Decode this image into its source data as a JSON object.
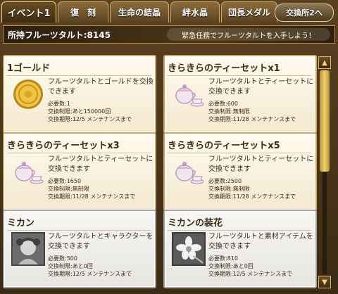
{
  "tabs": [
    {
      "label": "イベント1",
      "active": true
    },
    {
      "label": "復　刻",
      "active": false
    },
    {
      "label": "生命の結晶",
      "active": false
    },
    {
      "label": "絆水晶",
      "active": false
    },
    {
      "label": "団長メダル",
      "active": false
    }
  ],
  "exchange_button": "交換所2へ",
  "info": {
    "owned": "所持フルーツタルト:8145",
    "notice": "緊急任務でフルーツタルトを入手しよう！"
  },
  "items": [
    {
      "title": "1ゴールド",
      "icon": "gold-coin-icon",
      "desc": "フルーツタルトとゴールドを交換できます",
      "required": "必要数:1",
      "limit": "交換制限:あと150000回",
      "deadline": "交換期限:12/5 メンテナンスまで"
    },
    {
      "title": "きらきらのティーセットx1",
      "icon": "tea-set-icon",
      "desc": "フルーツタルトとティーセットに交換できます",
      "required": "必要数:600",
      "limit": "交換制限:無制限",
      "deadline": "交換期限:11/28 メンテナンスまで"
    },
    {
      "title": "きらきらのティーセットx3",
      "icon": "tea-set-icon",
      "desc": "フルーツタルトとティーセットに交換できます",
      "required": "必要数:1650",
      "limit": "交換制限:無制限",
      "deadline": "交換期限:11/28 メンテナンスまで"
    },
    {
      "title": "きらきらのティーセットx5",
      "icon": "tea-set-icon",
      "desc": "フルーツタルトとティーセットに交換できます",
      "required": "必要数:2500",
      "limit": "交換制限:無制限",
      "deadline": "交換期限:11/28 メンテナンスまで"
    },
    {
      "title": "ミカン",
      "icon": "character-portrait-icon",
      "desc": "フルーツタルトとキャラクターを交換できます",
      "required": "必要数:500",
      "limit": "交換制限:あと0回",
      "deadline": "交換期限:12/5 メンテナンスまで"
    },
    {
      "title": "ミカンの装花",
      "icon": "flower-ornament-icon",
      "desc": "フルーツタルトと素材アイテムを交換できます",
      "required": "必要数:810",
      "limit": "交換制限:あと0回",
      "deadline": "交換期限:12/5 メンテナンスまで"
    }
  ],
  "colors": {
    "card_border": "#c8a866",
    "gray_border": "#a5a39c",
    "text": "#3b2a15",
    "gold": "#e8b92c"
  }
}
